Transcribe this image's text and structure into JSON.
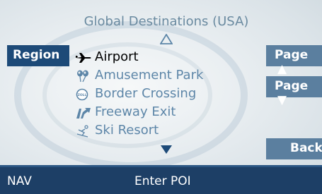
{
  "header": {
    "title": "Global Destinations (USA)"
  },
  "buttons": {
    "region": "Region",
    "page_up": "Page",
    "page_down": "Page",
    "back": "Back"
  },
  "poi_list": [
    {
      "label": "Airport",
      "icon": "airplane-icon",
      "selected": true
    },
    {
      "label": "Amusement Park",
      "icon": "balloons-icon",
      "selected": false
    },
    {
      "label": "Border Crossing",
      "icon": "customs-icon",
      "selected": false
    },
    {
      "label": "Freeway Exit",
      "icon": "freeway-exit-icon",
      "selected": false
    },
    {
      "label": "Ski Resort",
      "icon": "skier-icon",
      "selected": false
    }
  ],
  "status_bar": {
    "left": "NAV",
    "center": "Enter POI"
  },
  "colors": {
    "item_text": "#5d86a8",
    "selected_text": "#000000",
    "button_bg": "#5b7f9f",
    "region_bg": "#1d4a78",
    "status_bar_bg": "#1d3f66"
  }
}
